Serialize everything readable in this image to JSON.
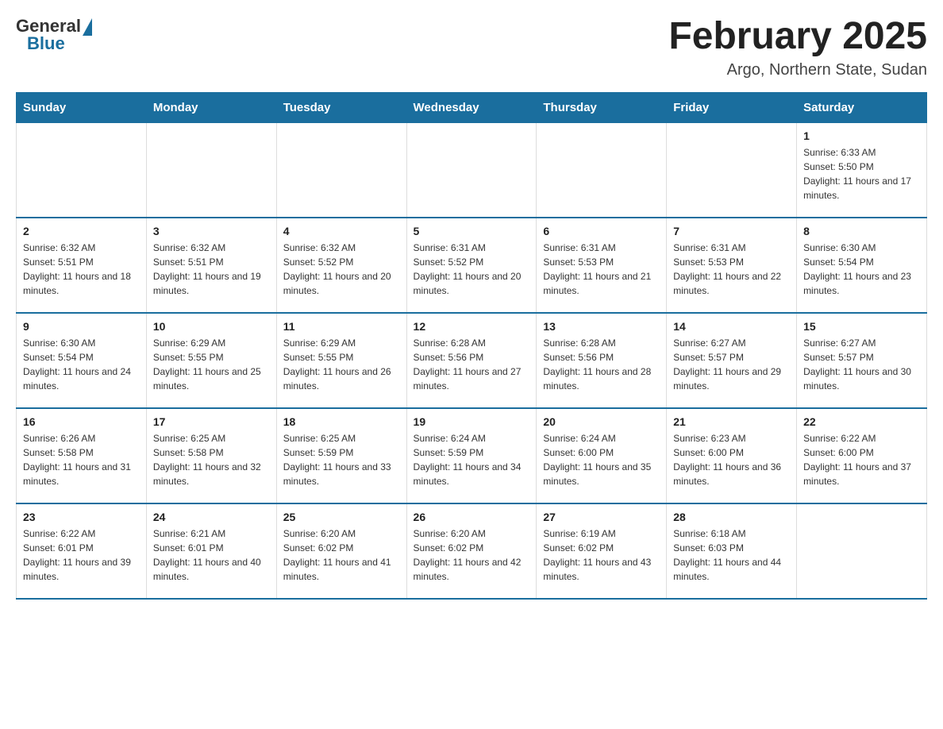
{
  "logo": {
    "general": "General",
    "blue": "Blue"
  },
  "title": "February 2025",
  "location": "Argo, Northern State, Sudan",
  "days_of_week": [
    "Sunday",
    "Monday",
    "Tuesday",
    "Wednesday",
    "Thursday",
    "Friday",
    "Saturday"
  ],
  "weeks": [
    [
      {
        "day": "",
        "info": ""
      },
      {
        "day": "",
        "info": ""
      },
      {
        "day": "",
        "info": ""
      },
      {
        "day": "",
        "info": ""
      },
      {
        "day": "",
        "info": ""
      },
      {
        "day": "",
        "info": ""
      },
      {
        "day": "1",
        "info": "Sunrise: 6:33 AM\nSunset: 5:50 PM\nDaylight: 11 hours and 17 minutes."
      }
    ],
    [
      {
        "day": "2",
        "info": "Sunrise: 6:32 AM\nSunset: 5:51 PM\nDaylight: 11 hours and 18 minutes."
      },
      {
        "day": "3",
        "info": "Sunrise: 6:32 AM\nSunset: 5:51 PM\nDaylight: 11 hours and 19 minutes."
      },
      {
        "day": "4",
        "info": "Sunrise: 6:32 AM\nSunset: 5:52 PM\nDaylight: 11 hours and 20 minutes."
      },
      {
        "day": "5",
        "info": "Sunrise: 6:31 AM\nSunset: 5:52 PM\nDaylight: 11 hours and 20 minutes."
      },
      {
        "day": "6",
        "info": "Sunrise: 6:31 AM\nSunset: 5:53 PM\nDaylight: 11 hours and 21 minutes."
      },
      {
        "day": "7",
        "info": "Sunrise: 6:31 AM\nSunset: 5:53 PM\nDaylight: 11 hours and 22 minutes."
      },
      {
        "day": "8",
        "info": "Sunrise: 6:30 AM\nSunset: 5:54 PM\nDaylight: 11 hours and 23 minutes."
      }
    ],
    [
      {
        "day": "9",
        "info": "Sunrise: 6:30 AM\nSunset: 5:54 PM\nDaylight: 11 hours and 24 minutes."
      },
      {
        "day": "10",
        "info": "Sunrise: 6:29 AM\nSunset: 5:55 PM\nDaylight: 11 hours and 25 minutes."
      },
      {
        "day": "11",
        "info": "Sunrise: 6:29 AM\nSunset: 5:55 PM\nDaylight: 11 hours and 26 minutes."
      },
      {
        "day": "12",
        "info": "Sunrise: 6:28 AM\nSunset: 5:56 PM\nDaylight: 11 hours and 27 minutes."
      },
      {
        "day": "13",
        "info": "Sunrise: 6:28 AM\nSunset: 5:56 PM\nDaylight: 11 hours and 28 minutes."
      },
      {
        "day": "14",
        "info": "Sunrise: 6:27 AM\nSunset: 5:57 PM\nDaylight: 11 hours and 29 minutes."
      },
      {
        "day": "15",
        "info": "Sunrise: 6:27 AM\nSunset: 5:57 PM\nDaylight: 11 hours and 30 minutes."
      }
    ],
    [
      {
        "day": "16",
        "info": "Sunrise: 6:26 AM\nSunset: 5:58 PM\nDaylight: 11 hours and 31 minutes."
      },
      {
        "day": "17",
        "info": "Sunrise: 6:25 AM\nSunset: 5:58 PM\nDaylight: 11 hours and 32 minutes."
      },
      {
        "day": "18",
        "info": "Sunrise: 6:25 AM\nSunset: 5:59 PM\nDaylight: 11 hours and 33 minutes."
      },
      {
        "day": "19",
        "info": "Sunrise: 6:24 AM\nSunset: 5:59 PM\nDaylight: 11 hours and 34 minutes."
      },
      {
        "day": "20",
        "info": "Sunrise: 6:24 AM\nSunset: 6:00 PM\nDaylight: 11 hours and 35 minutes."
      },
      {
        "day": "21",
        "info": "Sunrise: 6:23 AM\nSunset: 6:00 PM\nDaylight: 11 hours and 36 minutes."
      },
      {
        "day": "22",
        "info": "Sunrise: 6:22 AM\nSunset: 6:00 PM\nDaylight: 11 hours and 37 minutes."
      }
    ],
    [
      {
        "day": "23",
        "info": "Sunrise: 6:22 AM\nSunset: 6:01 PM\nDaylight: 11 hours and 39 minutes."
      },
      {
        "day": "24",
        "info": "Sunrise: 6:21 AM\nSunset: 6:01 PM\nDaylight: 11 hours and 40 minutes."
      },
      {
        "day": "25",
        "info": "Sunrise: 6:20 AM\nSunset: 6:02 PM\nDaylight: 11 hours and 41 minutes."
      },
      {
        "day": "26",
        "info": "Sunrise: 6:20 AM\nSunset: 6:02 PM\nDaylight: 11 hours and 42 minutes."
      },
      {
        "day": "27",
        "info": "Sunrise: 6:19 AM\nSunset: 6:02 PM\nDaylight: 11 hours and 43 minutes."
      },
      {
        "day": "28",
        "info": "Sunrise: 6:18 AM\nSunset: 6:03 PM\nDaylight: 11 hours and 44 minutes."
      },
      {
        "day": "",
        "info": ""
      }
    ]
  ]
}
